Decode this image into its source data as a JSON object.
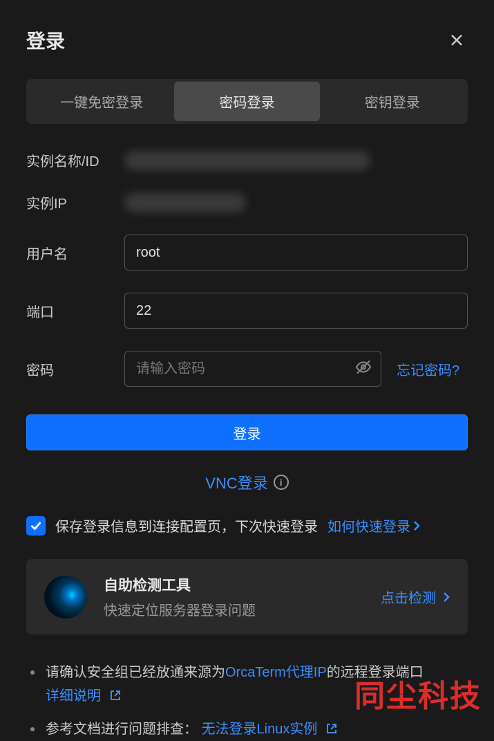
{
  "header": {
    "title": "登录"
  },
  "tabs": {
    "sso": "一键免密登录",
    "password": "密码登录",
    "key": "密钥登录"
  },
  "fields": {
    "instance_label": "实例名称/ID",
    "ip_label": "实例IP",
    "user_label": "用户名",
    "user_value": "root",
    "port_label": "端口",
    "port_value": "22",
    "password_label": "密码",
    "password_placeholder": "请输入密码",
    "forgot": "忘记密码?"
  },
  "login_button": "登录",
  "vnc": {
    "label": "VNC登录"
  },
  "save_info": {
    "text": "保存登录信息到连接配置页，下次快速登录",
    "link": "如何快速登录"
  },
  "detect": {
    "title": "自助检测工具",
    "subtitle": "快速定位服务器登录问题",
    "action": "点击检测"
  },
  "notes": {
    "n1_pre": "请确认安全组已经放通来源为",
    "n1_link": "OrcaTerm代理IP",
    "n1_post": "的远程登录端口",
    "n1_detail": "详细说明",
    "n2_pre": "参考文档进行问题排查：",
    "n2_link": "无法登录Linux实例"
  },
  "watermark": "同尘科技"
}
